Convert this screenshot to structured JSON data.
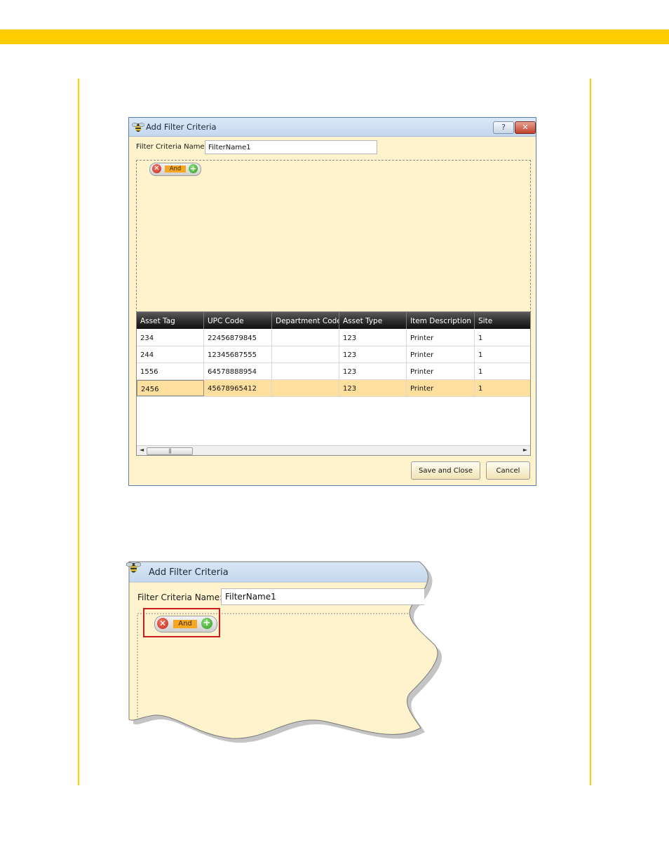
{
  "dialog": {
    "title": "Add Filter Criteria",
    "help_label": "?",
    "close_label": "✕",
    "name_label": "Filter Criteria Name:",
    "name_value": "FilterName1",
    "criteria": {
      "remove_glyph": "✕",
      "operator": "And",
      "add_glyph": "+"
    },
    "grid": {
      "columns": [
        "Asset Tag",
        "UPC Code",
        "Department Code",
        "Asset Type",
        "Item Description",
        "Site"
      ],
      "rows": [
        [
          "234",
          "22456879845",
          "",
          "123",
          "Printer",
          "1"
        ],
        [
          "244",
          "12345687555",
          "",
          "123",
          "Printer",
          "1"
        ],
        [
          "1556",
          "64578888954",
          "",
          "123",
          "Printer",
          "1"
        ],
        [
          "2456",
          "45678965412",
          "",
          "123",
          "Printer",
          "1"
        ]
      ],
      "scroll_left": "◄",
      "scroll_right": "►",
      "scroll_thumb": "|||"
    },
    "save_label": "Save and Close",
    "cancel_label": "Cancel"
  },
  "zoom": {
    "title": "Add Filter Criteria",
    "name_label": "Filter Criteria Name:",
    "name_value": "FilterName1",
    "remove_glyph": "✕",
    "operator": "And",
    "add_glyph": "+"
  },
  "colors": {
    "accent": "#ffcc00",
    "dialog_bg": "#fef3cd",
    "selected_row": "#ffdf9e",
    "highlight": "#cc1b1b"
  }
}
